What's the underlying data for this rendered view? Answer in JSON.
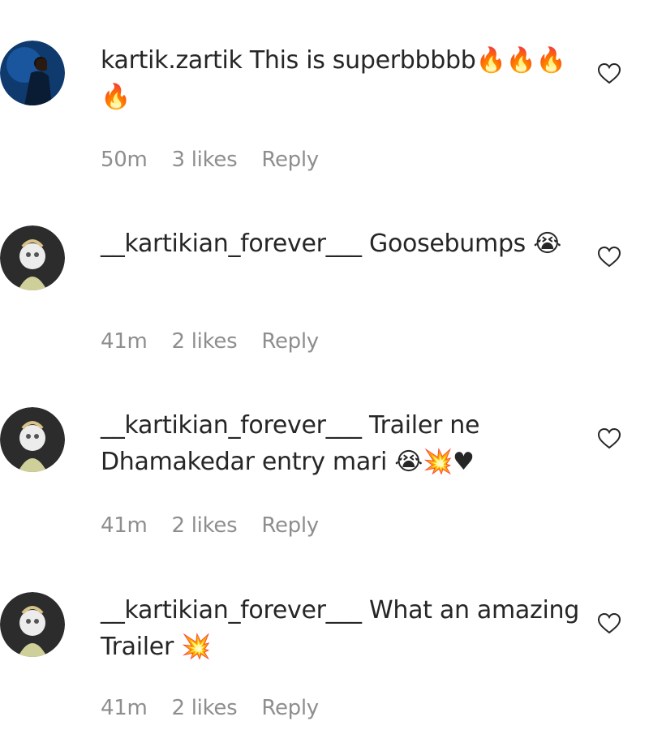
{
  "comments": [
    {
      "username": "kartik.zartik",
      "text": "This is superbbbbb🔥🔥🔥🔥",
      "time": "50m",
      "likes": "3 likes",
      "reply": "Reply",
      "avatar_icon": "profile-avatar-blue"
    },
    {
      "username": "__kartikian_forever___",
      "text": "Goosebumps 😭",
      "time": "41m",
      "likes": "2 likes",
      "reply": "Reply",
      "avatar_icon": "profile-avatar-dark"
    },
    {
      "username": "__kartikian_forever___",
      "text": "Trailer ne Dhamakedar entry mari 😭💥♥",
      "time": "41m",
      "likes": "2 likes",
      "reply": "Reply",
      "avatar_icon": "profile-avatar-dark"
    },
    {
      "username": "__kartikian_forever___",
      "text": "What an amazing Trailer 💥",
      "time": "41m",
      "likes": "2 likes",
      "reply": "Reply",
      "avatar_icon": "profile-avatar-dark"
    }
  ],
  "colors": {
    "text": "#262626",
    "meta": "#8e8e8e"
  },
  "icons": {
    "like": "heart-outline-icon"
  }
}
